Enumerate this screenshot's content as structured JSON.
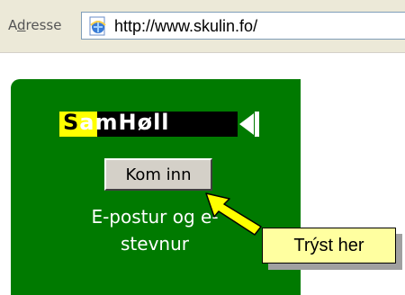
{
  "address_bar": {
    "label_prefix": "A",
    "label_underlined": "d",
    "label_rest": "resse",
    "url": "http://www.skulin.fo/",
    "icon": "ie-page-icon"
  },
  "panel": {
    "logo_first_letter": "S",
    "logo_rest": "amHøll",
    "button_label": "Kom inn",
    "text_line1": "E-postur og e-",
    "text_line2": "stevnur",
    "colors": {
      "background": "#007a00",
      "logo_highlight": "#ffff00"
    }
  },
  "callout": {
    "text": "Trýst her",
    "icon": "pointer-arrow"
  }
}
